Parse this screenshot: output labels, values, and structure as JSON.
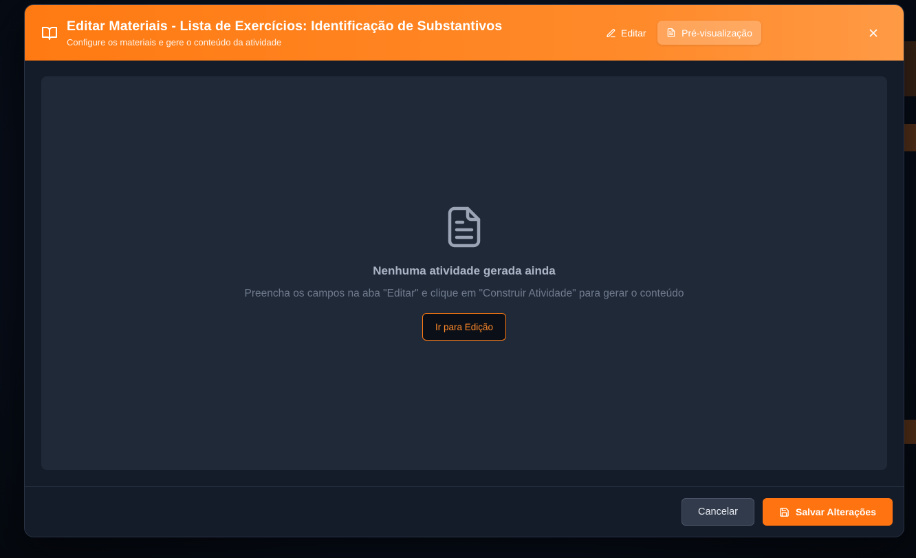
{
  "modal": {
    "title": "Editar Materiais - Lista de Exercícios: Identificação de Substantivos",
    "subtitle": "Configure os materiais e gere o conteúdo da atividade",
    "tabs": [
      {
        "label": "Editar",
        "icon": "pencil-icon",
        "active": false
      },
      {
        "label": "Pré-visualização",
        "icon": "file-text-icon",
        "active": true
      }
    ],
    "close_icon": "close-icon",
    "header_icon": "book-open-icon",
    "accent_color": "#ff7a12"
  },
  "empty_state": {
    "icon": "file-text-icon",
    "title": "Nenhuma atividade gerada ainda",
    "description": "Preencha os campos na aba \"Editar\" e clique em \"Construir Atividade\" para gerar o conteúdo",
    "button_label": "Ir para Edição"
  },
  "footer": {
    "cancel_label": "Cancelar",
    "save_label": "Salvar Alterações",
    "save_icon": "save-icon"
  }
}
